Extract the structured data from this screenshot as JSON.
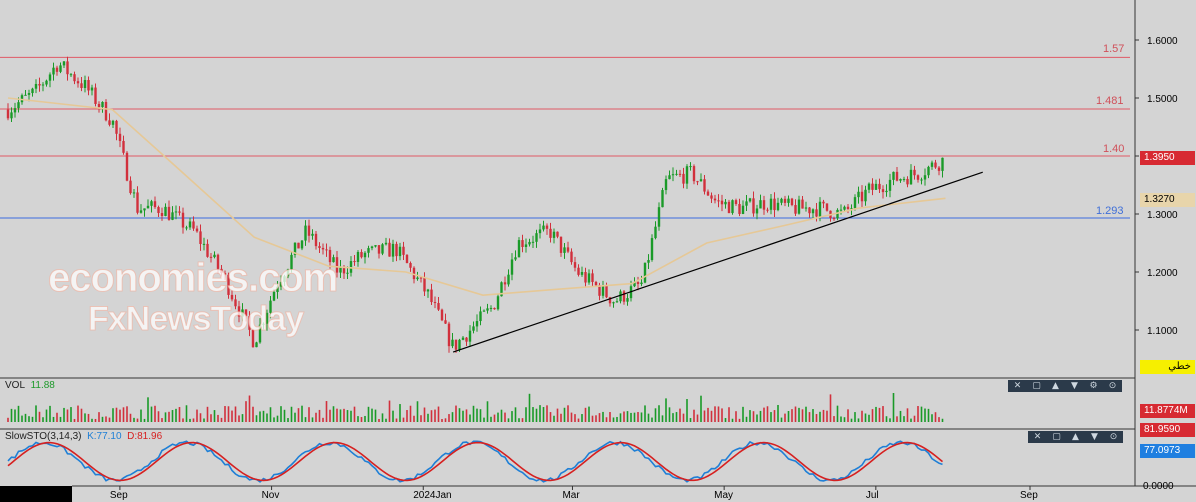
{
  "watermark": {
    "line1": "economies.com",
    "line2": "FxNewsToday"
  },
  "volume_panel": {
    "label": "VOL",
    "value": "11.88"
  },
  "stochastic_panel": {
    "label": "SlowSTO(3,14,3)",
    "k_text": "K:77.10",
    "d_text": "D:81.96"
  },
  "right_axis": {
    "price_ticks": [
      "1.6000",
      "1.5000",
      "1.4000",
      "1.3000",
      "1.2000",
      "1.1000"
    ],
    "last_price": "1.3950",
    "ma_price": "1.3270",
    "tool_tag": "خطي",
    "volume_tag": "11.8774M",
    "sto_d_tag": "81.9590",
    "sto_k_tag": "77.0973",
    "sto_bottom": "0.0000"
  },
  "x_axis": {
    "labels": [
      "Sep",
      "Nov",
      "2024Jan",
      "Mar",
      "May",
      "Jul",
      "Sep"
    ]
  },
  "colors": {
    "up": "#1a9a28",
    "down": "#d1303c",
    "ma": "#e6c896",
    "level_red": "#e05a66",
    "level_blue": "#3c6be0",
    "sto_k": "#1e7fd6",
    "sto_d": "#d62020"
  },
  "chart_data": {
    "type": "candlestick",
    "ylim": [
      1.02,
      1.67
    ],
    "levels": [
      {
        "label": "1.57",
        "value": 1.57,
        "color": "red"
      },
      {
        "label": "1.481",
        "value": 1.481,
        "color": "red"
      },
      {
        "label": "1.40",
        "value": 1.4,
        "color": "red"
      },
      {
        "label": "1.293",
        "value": 1.293,
        "color": "blue"
      }
    ],
    "trendline": {
      "from": {
        "date": "2024-01-20",
        "price": 1.062
      },
      "to": {
        "date": "2024-08-05",
        "price": 1.353
      }
    },
    "close_path": [
      {
        "date": "2023-07-25",
        "price": 1.48
      },
      {
        "date": "2023-08-05",
        "price": 1.51
      },
      {
        "date": "2023-08-14",
        "price": 1.56
      },
      {
        "date": "2023-08-25",
        "price": 1.52
      },
      {
        "date": "2023-09-05",
        "price": 1.46
      },
      {
        "date": "2023-09-15",
        "price": 1.31
      },
      {
        "date": "2023-09-25",
        "price": 1.31
      },
      {
        "date": "2023-10-08",
        "price": 1.27
      },
      {
        "date": "2023-10-20",
        "price": 1.19
      },
      {
        "date": "2023-11-01",
        "price": 1.08
      },
      {
        "date": "2023-11-10",
        "price": 1.18
      },
      {
        "date": "2023-11-22",
        "price": 1.27
      },
      {
        "date": "2023-12-05",
        "price": 1.2
      },
      {
        "date": "2023-12-15",
        "price": 1.23
      },
      {
        "date": "2023-12-28",
        "price": 1.24
      },
      {
        "date": "2024-01-10",
        "price": 1.16
      },
      {
        "date": "2024-01-20",
        "price": 1.07
      },
      {
        "date": "2024-02-05",
        "price": 1.14
      },
      {
        "date": "2024-02-15",
        "price": 1.25
      },
      {
        "date": "2024-02-28",
        "price": 1.27
      },
      {
        "date": "2024-03-10",
        "price": 1.2
      },
      {
        "date": "2024-03-25",
        "price": 1.15
      },
      {
        "date": "2024-04-05",
        "price": 1.18
      },
      {
        "date": "2024-04-15",
        "price": 1.36
      },
      {
        "date": "2024-04-25",
        "price": 1.37
      },
      {
        "date": "2024-05-05",
        "price": 1.32
      },
      {
        "date": "2024-05-15",
        "price": 1.31
      },
      {
        "date": "2024-05-25",
        "price": 1.32
      },
      {
        "date": "2024-06-05",
        "price": 1.31
      },
      {
        "date": "2024-06-15",
        "price": 1.31
      },
      {
        "date": "2024-06-25",
        "price": 1.3
      },
      {
        "date": "2024-07-05",
        "price": 1.34
      },
      {
        "date": "2024-07-15",
        "price": 1.36
      },
      {
        "date": "2024-07-25",
        "price": 1.37
      },
      {
        "date": "2024-08-05",
        "price": 1.395
      }
    ],
    "ma_path": [
      {
        "date": "2023-07-25",
        "price": 1.5
      },
      {
        "date": "2023-09-05",
        "price": 1.48
      },
      {
        "date": "2023-10-01",
        "price": 1.38
      },
      {
        "date": "2023-11-01",
        "price": 1.26
      },
      {
        "date": "2023-12-01",
        "price": 1.21
      },
      {
        "date": "2024-01-01",
        "price": 1.2
      },
      {
        "date": "2024-02-01",
        "price": 1.16
      },
      {
        "date": "2024-03-01",
        "price": 1.17
      },
      {
        "date": "2024-04-01",
        "price": 1.18
      },
      {
        "date": "2024-05-01",
        "price": 1.25
      },
      {
        "date": "2024-06-01",
        "price": 1.28
      },
      {
        "date": "2024-07-01",
        "price": 1.31
      },
      {
        "date": "2024-08-05",
        "price": 1.327
      }
    ]
  }
}
